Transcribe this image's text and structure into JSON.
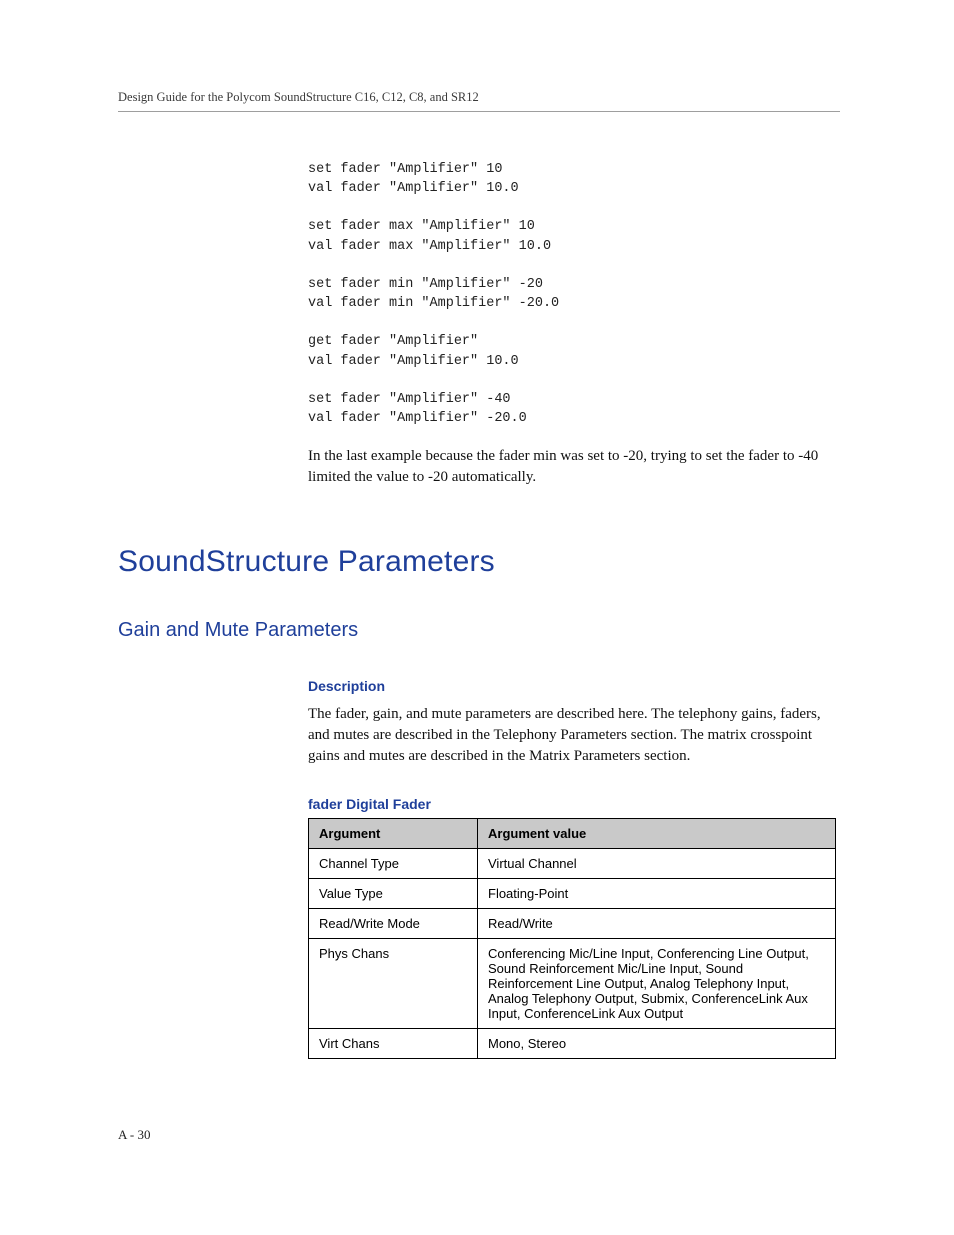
{
  "header": {
    "running_title": "Design Guide for the Polycom SoundStructure C16, C12, C8, and SR12"
  },
  "code_block": "set fader \"Amplifier\" 10\nval fader \"Amplifier\" 10.0\n\nset fader max \"Amplifier\" 10\nval fader max \"Amplifier\" 10.0\n\nset fader min \"Amplifier\" -20\nval fader min \"Amplifier\" -20.0\n\nget fader \"Amplifier\"\nval fader \"Amplifier\" 10.0\n\nset fader \"Amplifier\" -40\nval fader \"Amplifier\" -20.0",
  "body_para": "In the last example because the fader min was set to -20, trying to set the fader to -40 limited the value to -20 automatically.",
  "h1": "SoundStructure Parameters",
  "h2": "Gain and Mute Parameters",
  "description": {
    "heading": "Description",
    "text": "The fader, gain, and mute parameters are described here. The telephony gains, faders, and mutes are described in the Telephony Parameters section. The matrix crosspoint gains and mutes are described in the Matrix Parameters section."
  },
  "table": {
    "title": "fader Digital Fader",
    "head": {
      "c0": "Argument",
      "c1": "Argument value"
    },
    "rows": [
      {
        "arg": "Channel Type",
        "val": "Virtual Channel"
      },
      {
        "arg": "Value Type",
        "val": "Floating-Point"
      },
      {
        "arg": "Read/Write Mode",
        "val": "Read/Write"
      },
      {
        "arg": "Phys Chans",
        "val": "Conferencing Mic/Line Input, Conferencing Line Output, Sound Reinforcement Mic/Line Input, Sound Reinforcement Line Output, Analog Telephony Input, Analog Telephony Output, Submix, ConferenceLink Aux Input, ConferenceLink Aux Output"
      },
      {
        "arg": "Virt Chans",
        "val": "Mono, Stereo"
      }
    ]
  },
  "footer": {
    "page_number": "A - 30"
  }
}
